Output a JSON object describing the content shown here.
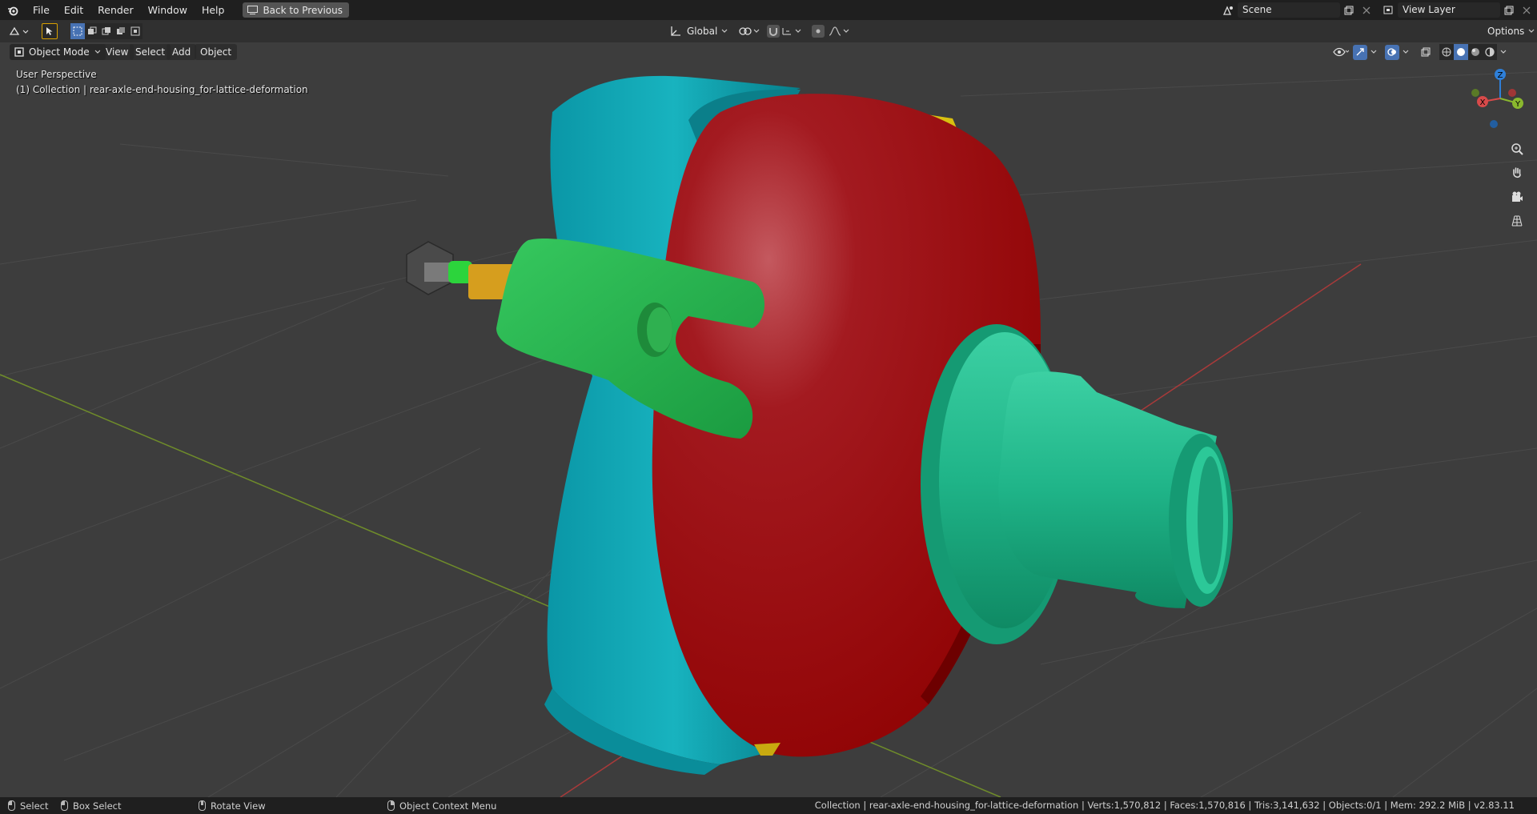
{
  "topbar": {
    "menus": [
      "File",
      "Edit",
      "Render",
      "Window",
      "Help"
    ],
    "back_label": "Back to Previous",
    "scene_name": "Scene",
    "view_layer_name": "View Layer"
  },
  "header": {
    "transform_orientation": "Global",
    "options_label": "Options"
  },
  "moderow": {
    "mode": "Object Mode",
    "menus": [
      "View",
      "Select",
      "Add",
      "Object"
    ]
  },
  "viewport": {
    "perspective_label": "User Perspective",
    "collection_label": "(1) Collection | rear-axle-end-housing_for-lattice-deformation",
    "gizmo_axes": [
      "X",
      "Y",
      "Z"
    ],
    "colors": {
      "background": "#3d3d3d",
      "teal_flange": "#0fa7b0",
      "red_housing": "#a00f12",
      "green_bracket": "#22b14c",
      "mint_hub": "#1bb88a",
      "orange_shaft": "#d4a020",
      "yellow_rim": "#d8c010",
      "x_axis": "#b03030",
      "y_axis": "#7a9a2a"
    }
  },
  "statusbar": {
    "select": "Select",
    "box_select": "Box Select",
    "rotate_view": "Rotate View",
    "context_menu": "Object Context Menu",
    "stats": "Collection | rear-axle-end-housing_for-lattice-deformation | Verts:1,570,812 | Faces:1,570,816 | Tris:3,141,632 | Objects:0/1 | Mem: 292.2 MiB | v2.83.11"
  }
}
